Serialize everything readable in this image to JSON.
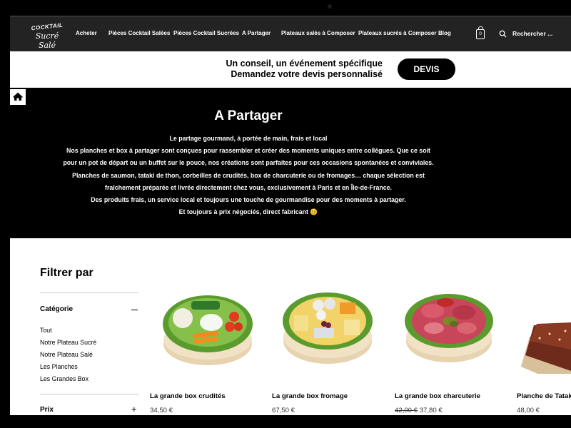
{
  "nav": {
    "logo_line1": "COCKTAIL",
    "logo_line2": "Sucré Salé",
    "items": [
      {
        "label": "Acheter"
      },
      {
        "label": "Pièces Cocktail Salées"
      },
      {
        "label": "Pièces Cocktail Sucrées"
      },
      {
        "label": "A Partager"
      },
      {
        "label": "Plateaux salés à Composer"
      },
      {
        "label": "Plateaux sucrés à Composer"
      },
      {
        "label": "Blog"
      }
    ],
    "cart_count": "0",
    "search_label": "Rechercher ..."
  },
  "promo": {
    "line1": "Un conseil, un événement spécifique",
    "line2": "Demandez votre devis personnalisé",
    "button": "DEVIS"
  },
  "hero": {
    "title": "A Partager",
    "lines": [
      "Le partage gourmand, à portée de main, frais et local",
      "Nos planches et box à partager sont conçues pour rassembler et créer des moments uniques entre collègues. Que ce soit",
      "pour un pot de départ ou un buffet sur le pouce, nos créations sont parfaites pour ces occasions spontanées et conviviales.",
      "Planches de saumon, tataki de thon, corbeilles de crudités, box de charcuterie ou de fromages… chaque sélection est",
      "fraîchement préparée et livrée directement chez vous, exclusivement à Paris et en Île-de-France.",
      "Des produits frais, un service local et toujours une touche de gourmandise pour des moments à partager.",
      "Et toujours à prix négociés, direct fabricant 😊"
    ]
  },
  "filters": {
    "title": "Filtrer par",
    "category_title": "Catégorie",
    "categories": [
      "Tout",
      "Notre Plateau Sucré",
      "Notre Plateau Salé",
      "Les Planches",
      "Les Grandes Box"
    ],
    "price_title": "Prix"
  },
  "products": [
    {
      "name": "La grande box crudités",
      "price": "34,50 €",
      "old_price": ""
    },
    {
      "name": "La grande box fromage",
      "price": "67,50 €",
      "old_price": ""
    },
    {
      "name": "La grande box charcuterie",
      "price": "37,80 €",
      "old_price": "42,00 €"
    },
    {
      "name": "Planche de Tataki",
      "price": "48,00 €",
      "old_price": ""
    }
  ],
  "colors": {
    "nav_bg": "#232323",
    "hero_bg": "#000000",
    "button_bg": "#000000",
    "text": "#000000"
  }
}
